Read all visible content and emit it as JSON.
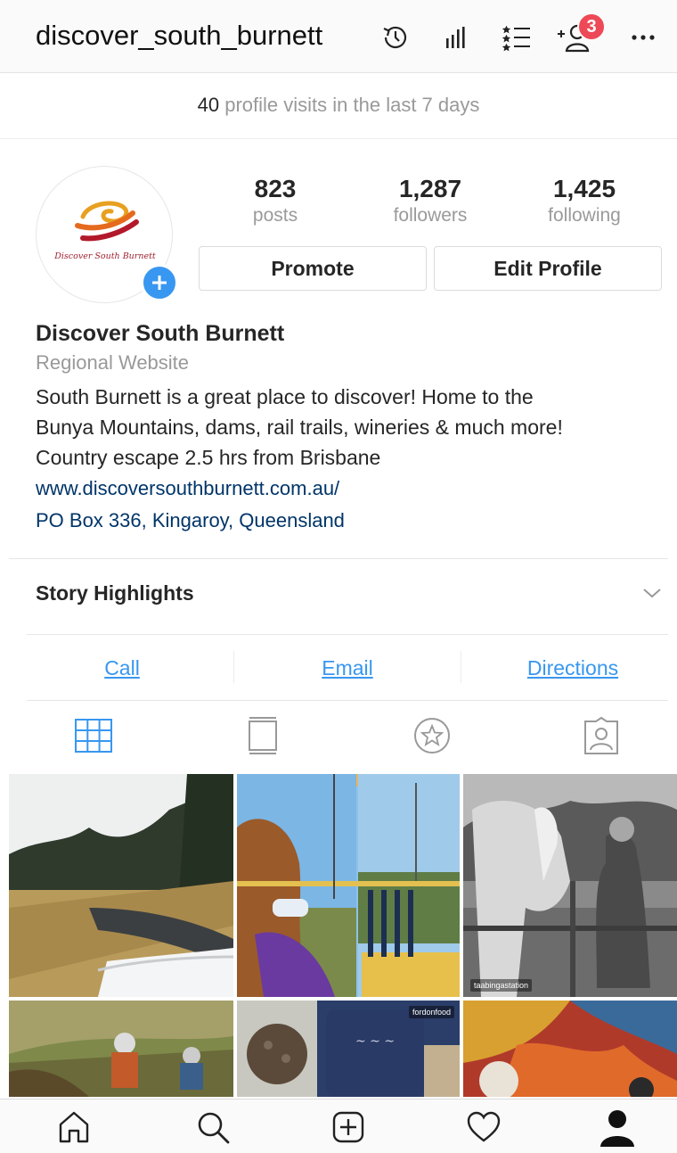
{
  "header": {
    "username": "discover_south_burnett",
    "notification_count": "3",
    "icons": [
      "archive-icon",
      "insights-icon",
      "saved-list-icon",
      "discover-people-icon",
      "more-icon"
    ]
  },
  "visits": {
    "count": "40",
    "text": "profile visits in the last 7 days"
  },
  "profile": {
    "logo_text": "Discover South Burnett",
    "stats": [
      {
        "value": "823",
        "label": "posts"
      },
      {
        "value": "1,287",
        "label": "followers"
      },
      {
        "value": "1,425",
        "label": "following"
      }
    ],
    "promote_label": "Promote",
    "edit_label": "Edit Profile",
    "name": "Discover South Burnett",
    "category": "Regional Website",
    "bio_lines": [
      "South Burnett is a great place to discover! Home to the",
      "Bunya Mountains, dams, rail trails, wineries & much more!",
      "Country escape 2.5 hrs from Brisbane"
    ],
    "website": "www.discoversouthburnett.com.au/",
    "address": "PO Box 336, Kingaroy, Queensland"
  },
  "story_highlights": {
    "label": "Story Highlights"
  },
  "actions": {
    "call": "Call",
    "email": "Email",
    "directions": "Directions"
  },
  "tabs": [
    "grid-icon",
    "feed-icon",
    "saved-star-icon",
    "tagged-icon"
  ],
  "grid": {
    "tag_1": "taabingastation",
    "tag_2": "fordonfood"
  },
  "bottom_nav": [
    "home-icon",
    "search-icon",
    "new-post-icon",
    "activity-icon",
    "profile-icon"
  ],
  "colors": {
    "accent": "#3897f0",
    "badge": "#ed4956",
    "link": "#003569"
  }
}
